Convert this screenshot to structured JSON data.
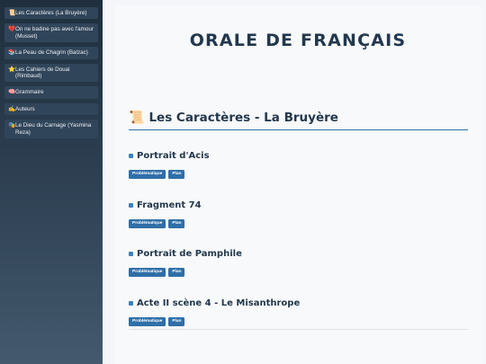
{
  "sidebar": {
    "items": [
      {
        "icon": "📜",
        "icon_name": "scroll-icon",
        "label": "Les Caractères (La Bruyère)"
      },
      {
        "icon": "💔",
        "icon_name": "broken-heart-icon",
        "label": "On ne badine pas avec l'amour (Musset)"
      },
      {
        "icon": "📚",
        "icon_name": "books-icon",
        "label": "La Peau de Chagrin (Balzac)"
      },
      {
        "icon": "⭐",
        "icon_name": "star-icon",
        "label": "Les Cahiers de Douai (Rimbaud)"
      },
      {
        "icon": "🧠",
        "icon_name": "brain-icon",
        "label": "Grammaire"
      },
      {
        "icon": "✍",
        "icon_name": "writing-hand-icon",
        "label": "Auteurs"
      },
      {
        "icon": "🎭",
        "icon_name": "theater-masks-icon",
        "label": "Le Dieu du Carnage (Yasmina Reza)"
      }
    ]
  },
  "main": {
    "title": "ORALE DE FRANÇAIS",
    "section": {
      "icon": "📜",
      "icon_name": "scroll-icon",
      "title": "Les Caractères - La Bruyère"
    },
    "entries": [
      {
        "title": "Portrait d'Acis",
        "buttons": [
          "Problématique",
          "Plan"
        ]
      },
      {
        "title": "Fragment 74",
        "buttons": [
          "Problématique",
          "Plan"
        ]
      },
      {
        "title": "Portrait de Pamphile",
        "buttons": [
          "Problématique",
          "Plan"
        ]
      },
      {
        "title": "Acte II scène 4 - Le Misanthrope",
        "buttons": [
          "Problématique",
          "Plan"
        ]
      }
    ]
  },
  "colors": {
    "sidebar_bg": "#2c3e50",
    "title": "#22384d",
    "accent": "#2f6fa8"
  }
}
